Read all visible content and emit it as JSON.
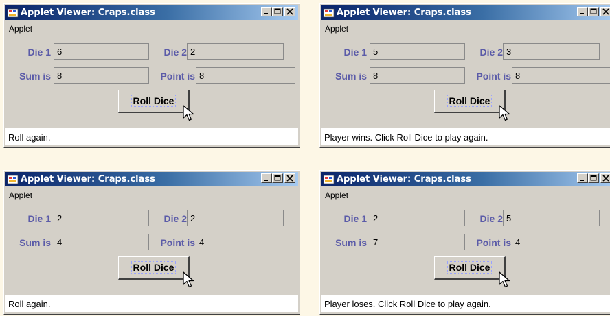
{
  "window_title": "Applet Viewer: Craps.class",
  "menu_label": "Applet",
  "labels": {
    "die1": "Die 1",
    "die2": "Die 2",
    "sum": "Sum is",
    "point": "Point is"
  },
  "button_label": "Roll Dice",
  "windows": [
    {
      "die1": "6",
      "die2": "2",
      "sum": "8",
      "point": "8",
      "status": "Roll again."
    },
    {
      "die1": "5",
      "die2": "3",
      "sum": "8",
      "point": "8",
      "status": "Player wins. Click Roll Dice to play again."
    },
    {
      "die1": "2",
      "die2": "2",
      "sum": "4",
      "point": "4",
      "status": "Roll again."
    },
    {
      "die1": "2",
      "die2": "5",
      "sum": "7",
      "point": "4",
      "status": "Player loses. Click Roll Dice to play again."
    }
  ]
}
